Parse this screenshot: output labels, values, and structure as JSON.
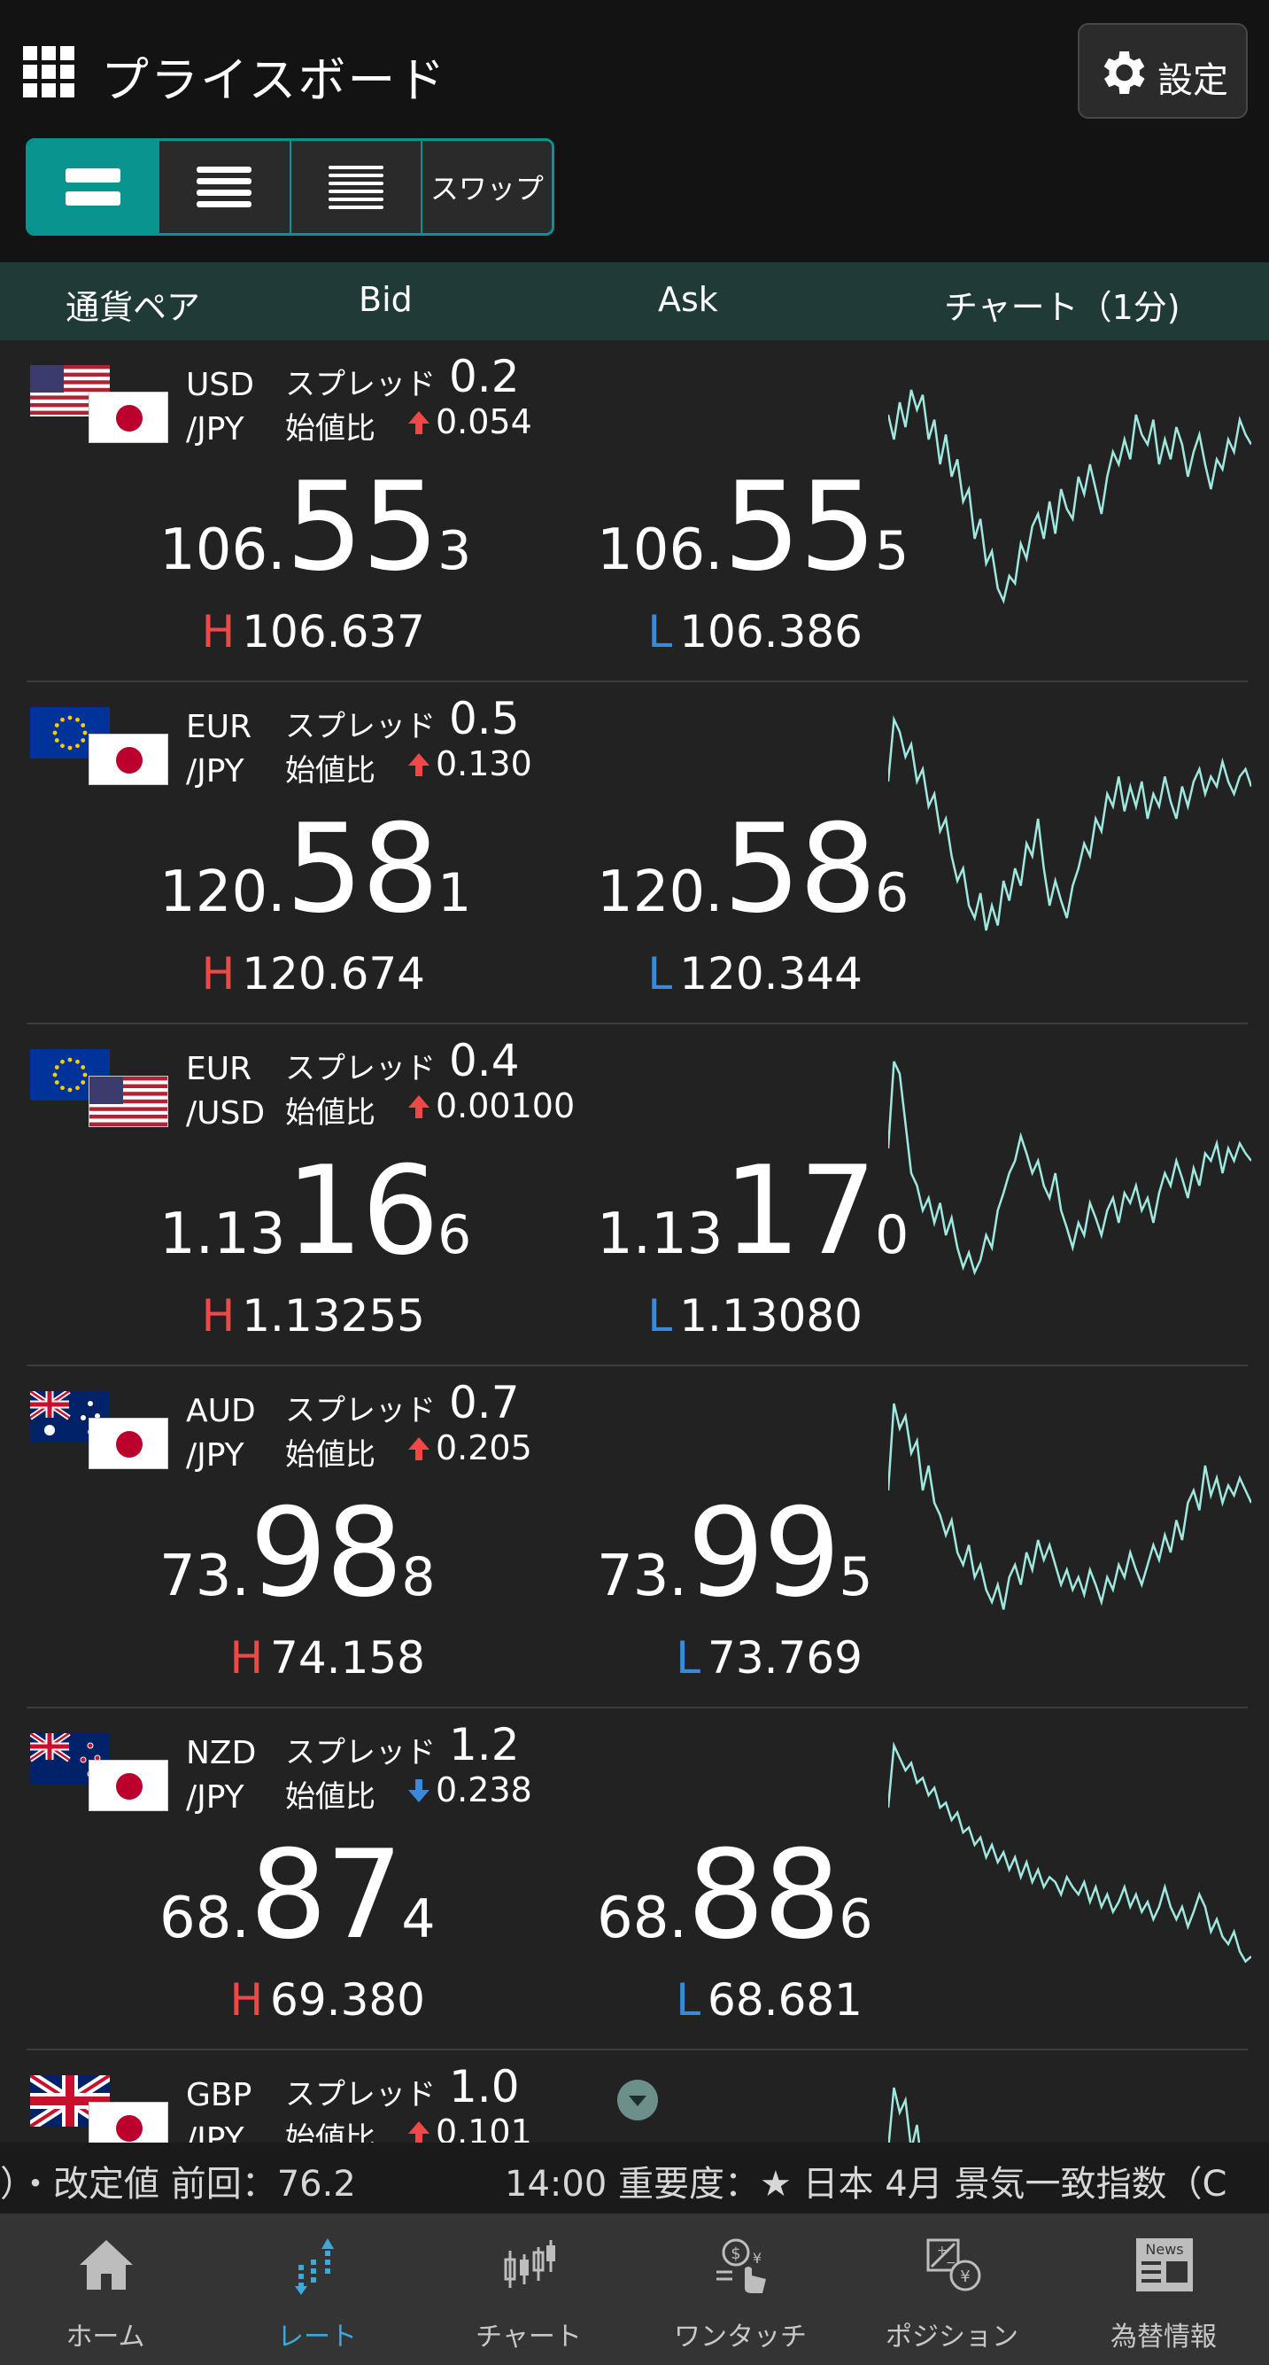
{
  "header": {
    "title": "プライスボード",
    "settings_label": "設定",
    "swap_label": "スワップ"
  },
  "columns": {
    "pair": "通貨ペア",
    "bid": "Bid",
    "ask": "Ask",
    "chart": "チャート（1分)"
  },
  "rows": [
    {
      "base": "USD",
      "quote": "/JPY",
      "spread_label": "スプレッド",
      "spread": "0.2",
      "change_label": "始値比",
      "change_dir": "up",
      "change": "0.054",
      "bid_pre": "106.",
      "bid_big": "55",
      "bid_small": "3",
      "ask_pre": "106.",
      "ask_big": "55",
      "ask_small": "5",
      "high_mark": "H",
      "high": "106.637",
      "low_mark": "L",
      "low": "106.386",
      "flags": [
        "us",
        "jp"
      ],
      "spark": [
        0.8,
        0.7,
        0.85,
        0.75,
        0.9,
        0.82,
        0.88,
        0.7,
        0.78,
        0.6,
        0.72,
        0.55,
        0.62,
        0.45,
        0.5,
        0.3,
        0.38,
        0.2,
        0.25,
        0.1,
        0.05,
        0.15,
        0.12,
        0.28,
        0.22,
        0.35,
        0.4,
        0.3,
        0.45,
        0.32,
        0.5,
        0.42,
        0.38,
        0.55,
        0.48,
        0.6,
        0.5,
        0.4,
        0.55,
        0.65,
        0.6,
        0.7,
        0.62,
        0.8,
        0.72,
        0.68,
        0.78,
        0.6,
        0.7,
        0.62,
        0.75,
        0.68,
        0.55,
        0.65,
        0.72,
        0.6,
        0.5,
        0.62,
        0.58,
        0.7,
        0.65,
        0.78,
        0.72,
        0.68
      ]
    },
    {
      "base": "EUR",
      "quote": "/JPY",
      "spread_label": "スプレッド",
      "spread": "0.5",
      "change_label": "始値比",
      "change_dir": "up",
      "change": "0.130",
      "bid_pre": "120.",
      "bid_big": "58",
      "bid_small": "1",
      "ask_pre": "120.",
      "ask_big": "58",
      "ask_small": "6",
      "high_mark": "H",
      "high": "120.674",
      "low_mark": "L",
      "low": "120.344",
      "flags": [
        "eu",
        "jp"
      ],
      "spark": [
        0.7,
        0.95,
        0.9,
        0.8,
        0.85,
        0.7,
        0.75,
        0.6,
        0.65,
        0.5,
        0.55,
        0.4,
        0.3,
        0.35,
        0.2,
        0.15,
        0.25,
        0.1,
        0.2,
        0.12,
        0.3,
        0.22,
        0.35,
        0.28,
        0.45,
        0.4,
        0.55,
        0.35,
        0.2,
        0.3,
        0.22,
        0.15,
        0.28,
        0.35,
        0.45,
        0.4,
        0.55,
        0.5,
        0.65,
        0.6,
        0.72,
        0.58,
        0.68,
        0.6,
        0.7,
        0.55,
        0.65,
        0.6,
        0.72,
        0.62,
        0.55,
        0.68,
        0.6,
        0.7,
        0.75,
        0.65,
        0.72,
        0.68,
        0.78,
        0.7,
        0.65,
        0.72,
        0.75,
        0.68
      ]
    },
    {
      "base": "EUR",
      "quote": "/USD",
      "spread_label": "スプレッド",
      "spread": "0.4",
      "change_label": "始値比",
      "change_dir": "up",
      "change": "0.00100",
      "bid_pre": "1.13",
      "bid_big": "16",
      "bid_small": "6",
      "ask_pre": "1.13",
      "ask_big": "17",
      "ask_small": "0",
      "high_mark": "H",
      "high": "1.13255",
      "low_mark": "L",
      "low": "1.13080",
      "flags": [
        "eu",
        "us"
      ],
      "spark": [
        0.6,
        0.95,
        0.9,
        0.7,
        0.5,
        0.45,
        0.35,
        0.4,
        0.3,
        0.38,
        0.25,
        0.32,
        0.2,
        0.12,
        0.18,
        0.1,
        0.15,
        0.25,
        0.2,
        0.35,
        0.42,
        0.5,
        0.55,
        0.65,
        0.58,
        0.5,
        0.55,
        0.45,
        0.4,
        0.5,
        0.35,
        0.28,
        0.2,
        0.3,
        0.25,
        0.38,
        0.32,
        0.25,
        0.35,
        0.4,
        0.3,
        0.42,
        0.38,
        0.45,
        0.35,
        0.4,
        0.3,
        0.42,
        0.5,
        0.45,
        0.55,
        0.48,
        0.4,
        0.52,
        0.45,
        0.58,
        0.55,
        0.62,
        0.5,
        0.6,
        0.55,
        0.62,
        0.58,
        0.55
      ]
    },
    {
      "base": "AUD",
      "quote": "/JPY",
      "spread_label": "スプレッド",
      "spread": "0.7",
      "change_label": "始値比",
      "change_dir": "up",
      "change": "0.205",
      "bid_pre": "73.",
      "bid_big": "98",
      "bid_small": "8",
      "ask_pre": "73.",
      "ask_big": "99",
      "ask_small": "5",
      "high_mark": "H",
      "high": "74.158",
      "low_mark": "L",
      "low": "73.769",
      "flags": [
        "au",
        "jp"
      ],
      "spark": [
        0.6,
        0.95,
        0.85,
        0.9,
        0.75,
        0.8,
        0.6,
        0.7,
        0.55,
        0.5,
        0.42,
        0.48,
        0.35,
        0.3,
        0.38,
        0.25,
        0.3,
        0.2,
        0.15,
        0.22,
        0.12,
        0.25,
        0.3,
        0.22,
        0.35,
        0.28,
        0.4,
        0.32,
        0.38,
        0.3,
        0.22,
        0.28,
        0.2,
        0.25,
        0.18,
        0.28,
        0.22,
        0.15,
        0.25,
        0.2,
        0.3,
        0.25,
        0.35,
        0.28,
        0.22,
        0.3,
        0.38,
        0.32,
        0.42,
        0.35,
        0.48,
        0.4,
        0.55,
        0.6,
        0.52,
        0.7,
        0.58,
        0.65,
        0.55,
        0.62,
        0.58,
        0.65,
        0.6,
        0.55
      ]
    },
    {
      "base": "NZD",
      "quote": "/JPY",
      "spread_label": "スプレッド",
      "spread": "1.2",
      "change_label": "始値比",
      "change_dir": "down",
      "change": "0.238",
      "bid_pre": "68.",
      "bid_big": "87",
      "bid_small": "4",
      "ask_pre": "68.",
      "ask_big": "88",
      "ask_small": "6",
      "high_mark": "H",
      "high": "69.380",
      "low_mark": "L",
      "low": "68.681",
      "flags": [
        "nz",
        "jp"
      ],
      "spark": [
        0.7,
        0.95,
        0.9,
        0.85,
        0.88,
        0.8,
        0.82,
        0.75,
        0.78,
        0.7,
        0.72,
        0.65,
        0.68,
        0.6,
        0.62,
        0.55,
        0.58,
        0.5,
        0.55,
        0.48,
        0.52,
        0.45,
        0.5,
        0.42,
        0.48,
        0.4,
        0.45,
        0.38,
        0.42,
        0.4,
        0.35,
        0.42,
        0.38,
        0.35,
        0.4,
        0.32,
        0.38,
        0.3,
        0.35,
        0.28,
        0.32,
        0.38,
        0.3,
        0.35,
        0.28,
        0.32,
        0.25,
        0.3,
        0.38,
        0.3,
        0.25,
        0.3,
        0.22,
        0.28,
        0.35,
        0.3,
        0.2,
        0.25,
        0.18,
        0.15,
        0.2,
        0.12,
        0.08,
        0.1
      ]
    },
    {
      "base": "GBP",
      "quote": "/JPY",
      "spread_label": "スプレッド",
      "spread": "1.0",
      "change_label": "始値比",
      "change_dir": "up",
      "change": "0.101",
      "bid_pre": "",
      "bid_big": "",
      "bid_small": "",
      "ask_pre": "",
      "ask_big": "",
      "ask_small": "",
      "high_mark": "",
      "high": "",
      "low_mark": "",
      "low": "",
      "flags": [
        "gb",
        "jp"
      ],
      "spark": [
        0.7,
        0.95,
        0.85,
        0.9,
        0.7,
        0.8,
        0.6,
        0.65
      ]
    }
  ],
  "ticker": {
    "left": "）・改定値 前回：76.2",
    "right": "14:00 重要度：★ 日本 4月 景気一致指数（C"
  },
  "nav": [
    {
      "label": "ホーム",
      "icon": "home-icon",
      "active": false
    },
    {
      "label": "レート",
      "icon": "rate-icon",
      "active": true
    },
    {
      "label": "チャート",
      "icon": "candlestick-icon",
      "active": false
    },
    {
      "label": "ワンタッチ",
      "icon": "one-touch-icon",
      "active": false
    },
    {
      "label": "ポジション",
      "icon": "position-icon",
      "active": false
    },
    {
      "label": "為替情報",
      "icon": "news-icon",
      "active": false
    }
  ],
  "colors": {
    "accent": "#0a9490",
    "up": "#f04848",
    "down": "#3b8ad9",
    "spark": "#9fe8df",
    "header_bar": "#1f3a37"
  }
}
